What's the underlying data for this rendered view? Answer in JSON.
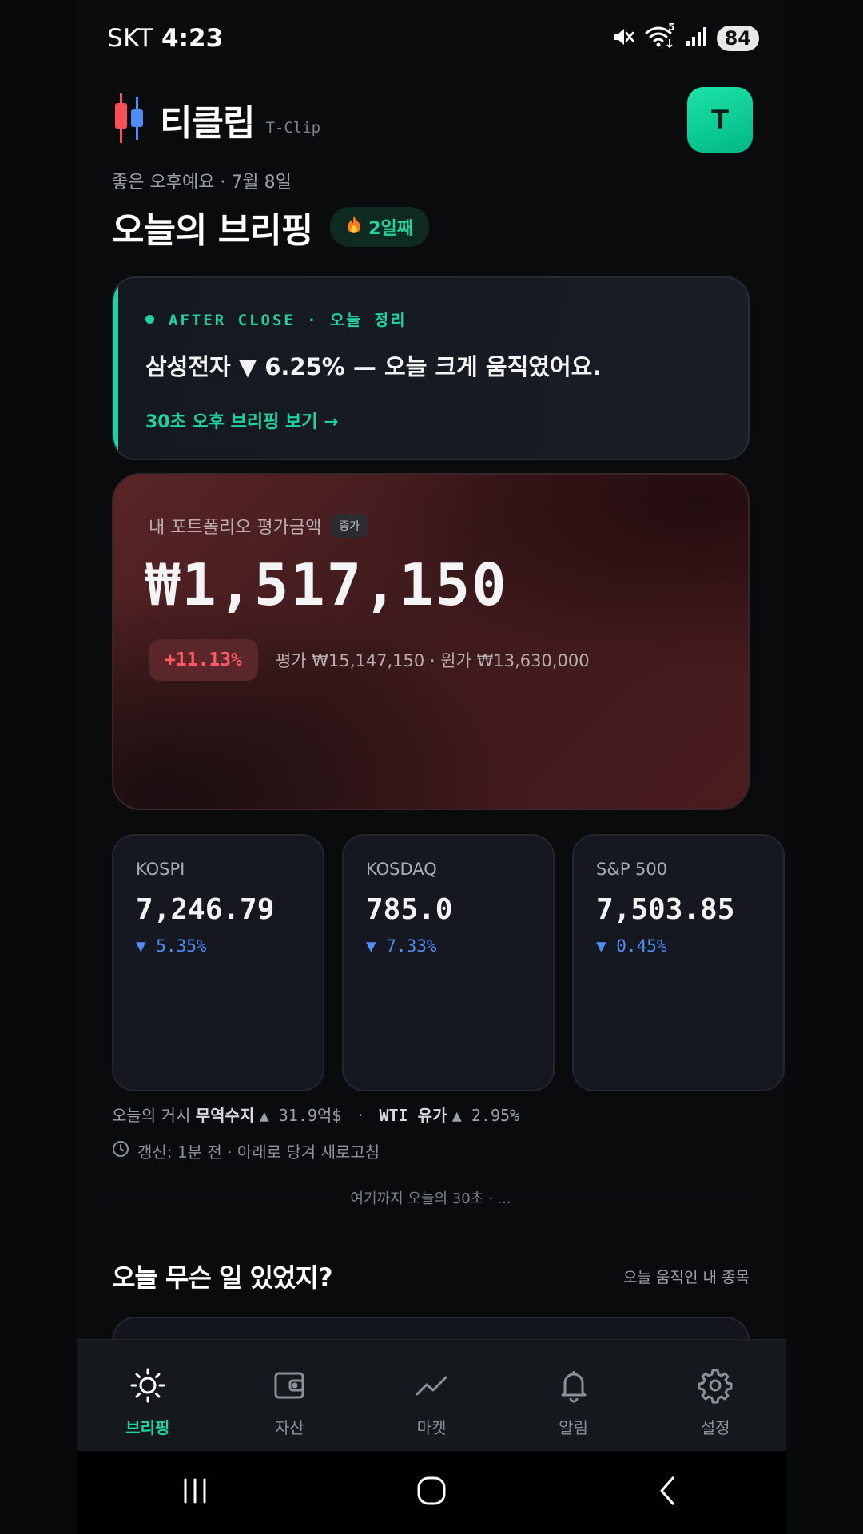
{
  "status_bar": {
    "carrier": "SKT",
    "time": "4:23",
    "battery": "84",
    "wifi_badge": "5"
  },
  "header": {
    "app_name": "티클립",
    "app_sub": "T-Clip",
    "avatar_letter": "T"
  },
  "greeting": "좋은 오후예요 · 7월 8일",
  "page_title": "오늘의 브리핑",
  "streak": "2일째",
  "brief_card": {
    "tag": "AFTER CLOSE · 오늘 정리",
    "headline": "삼성전자 ▼ 6.25% — 오늘 크게 움직였어요.",
    "link": "30초 오후 브리핑 보기 →"
  },
  "portfolio": {
    "label": "내 포트폴리오 평가금액",
    "pill": "종가",
    "value": "₩1,517,150",
    "change": "+11.13%",
    "detail": "평가 ₩15,147,150 · 원가 ₩13,630,000"
  },
  "indices": [
    {
      "name": "KOSPI",
      "value": "7,246.79",
      "change": "▼ 5.35%"
    },
    {
      "name": "KOSDAQ",
      "value": "785.0",
      "change": "▼ 7.33%"
    },
    {
      "name": "S&P 500",
      "value": "7,503.85",
      "change": "▼ 0.45%"
    }
  ],
  "ticker": {
    "prefix": "오늘의 거시",
    "item1_label": "무역수지",
    "item1_value": "▲ 31.9억$",
    "sep": "·",
    "item2_label": "WTI 유가",
    "item2_value": "▲ 2.95%"
  },
  "refresh": "갱신: 1분 전 · 아래로 당겨 새로고침",
  "divider_text": "여기까지 오늘의 30초 · ...",
  "section": {
    "title": "오늘 무슨 일 있었지?",
    "link": "오늘 움직인 내 종목"
  },
  "tabs": [
    {
      "label": "브리핑",
      "icon": "sun-icon",
      "active": true
    },
    {
      "label": "자산",
      "icon": "wallet-icon",
      "active": false
    },
    {
      "label": "마켓",
      "icon": "chart-line-icon",
      "active": false
    },
    {
      "label": "알림",
      "icon": "bell-icon",
      "active": false
    },
    {
      "label": "설정",
      "icon": "gear-icon",
      "active": false
    }
  ],
  "colors": {
    "accent": "#1fd39e",
    "down_blue": "#4f8df6",
    "up_red": "#ff5a62",
    "background": "#0a0b0d"
  }
}
